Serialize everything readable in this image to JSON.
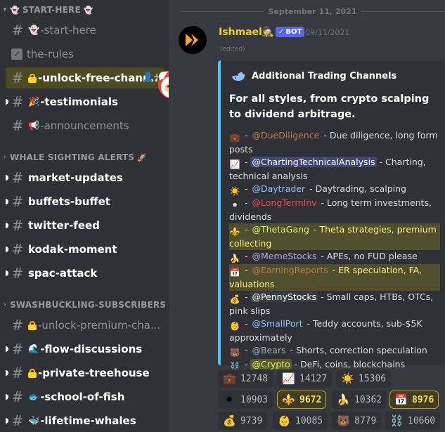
{
  "sidebar": {
    "categories": [
      {
        "label": "START-HERE",
        "icon_before": "👻",
        "icon_after": "👻",
        "collapsed": false
      },
      {
        "label": "WHALE SIGHTING ALERTS",
        "icon_after": "🚀",
        "collapsed": true
      },
      {
        "label": "SWASHBUCKLING-SUBSCRIBERS",
        "collapsed": true
      }
    ],
    "channels": [
      {
        "label": "-start-here",
        "emoji": "👻",
        "state": "read"
      },
      {
        "label": "the-rules",
        "emoji": "",
        "state": "read"
      },
      {
        "label": "-unlock-free-chann...",
        "emoji": "lock",
        "state": "selected"
      },
      {
        "label": "-testimonials",
        "emoji": "🎉",
        "state": "unread"
      },
      {
        "label": "-announcements",
        "emoji": "📢",
        "state": "read"
      },
      {
        "label": "market-updates",
        "emoji": "",
        "state": "unread"
      },
      {
        "label": "buffets-buffet",
        "emoji": "",
        "state": "unread"
      },
      {
        "label": "twitter-feed",
        "emoji": "",
        "state": "unread"
      },
      {
        "label": "kodak-moment",
        "emoji": "",
        "state": "unread"
      },
      {
        "label": "spac-attack",
        "emoji": "",
        "state": "unread"
      },
      {
        "label": "-unlock-premium-cha...",
        "emoji": "lock",
        "state": "read"
      },
      {
        "label": "-flow-discussions",
        "emoji": "🌊",
        "state": "unread"
      },
      {
        "label": "-private-treehouse",
        "emoji": "lock",
        "state": "unread"
      },
      {
        "label": "-school-of-fish",
        "emoji": "🐟",
        "state": "unread"
      },
      {
        "label": "-lifetime-whales",
        "emoji": "🐳",
        "state": "unread"
      }
    ]
  },
  "chat": {
    "date_divider": "September 11, 2021",
    "message": {
      "username": "Ishmael",
      "user_icon": "🕵",
      "bot_tag": "BOT",
      "timestamp": "09/11/2021",
      "edited": "(edited)"
    },
    "embed": {
      "accent_color": "#4fc3f7",
      "author_icon": "whale-icon",
      "author": "Additional Trading Channels",
      "title": "For all styles, from crypto scalping to dividend arbitrage.",
      "rows": [
        {
          "icon": "💼",
          "mention": "@DueDiligence",
          "text": " - Due diligence, long form posts"
        },
        {
          "icon": "📈",
          "mention": "@ChartingTechnicalAnalysis",
          "text": " - Charting, technical analysis"
        },
        {
          "icon": "☀️",
          "mention": "@Daytrader",
          "text": " - Daytrading, scalping"
        },
        {
          "icon": "⚫",
          "mention": "@LongTermInv",
          "text": " - Long term investments, dividends"
        },
        {
          "icon": "⚜️",
          "mention": "@ThetaGang",
          "text": " - Theta strategies, premium collecting"
        },
        {
          "icon": "🍌",
          "mention": "@MemeStocks",
          "text": " - APEs, no FUD please"
        },
        {
          "icon": "📅",
          "mention": "@EarningReports",
          "text": " - ER speculation, FA, valuations"
        },
        {
          "icon": "💰",
          "mention": "@PennyStocks",
          "text": " - Small caps, HTBs, OTCs, pink slips"
        },
        {
          "icon": "👶",
          "mention": "@SmallPort",
          "text": " - Teddy accounts, sub-$5K approximately"
        },
        {
          "icon": "🐻",
          "mention": "@Bears",
          "text": " - Shorts, correction speculation"
        },
        {
          "icon": "⛓️",
          "mention": "@Crypto",
          "text": " - DeFi, coins, blockchains"
        }
      ],
      "separator": " - "
    },
    "reactions": [
      {
        "emoji": "💼",
        "count": "12748",
        "active": false
      },
      {
        "emoji": "📈",
        "count": "14127",
        "active": false
      },
      {
        "emoji": "☀️",
        "count": "15306",
        "active": false
      },
      {
        "emoji": "⚫",
        "count": "10903",
        "active": false
      },
      {
        "emoji": "⚜️",
        "count": "9672",
        "active": true
      },
      {
        "emoji": "🍌",
        "count": "10362",
        "active": false
      },
      {
        "emoji": "📅",
        "count": "8976",
        "active": true
      },
      {
        "emoji": "💰",
        "count": "9739",
        "active": false
      },
      {
        "emoji": "👶",
        "count": "10085",
        "active": false
      },
      {
        "emoji": "🐻",
        "count": "8779",
        "active": false
      },
      {
        "emoji": "⛓️",
        "count": "10660",
        "active": false
      }
    ]
  }
}
